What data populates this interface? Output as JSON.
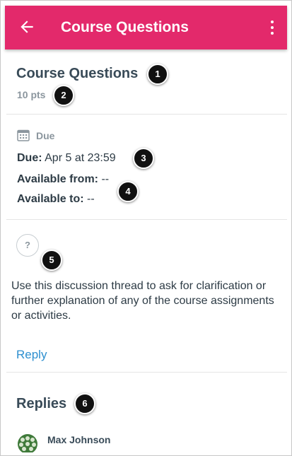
{
  "appbar": {
    "title": "Course Questions",
    "back_icon": "arrow-left-icon",
    "more_icon": "more-vertical-icon",
    "color": "#e3296b"
  },
  "assignment": {
    "title": "Course Questions",
    "points": "10 pts"
  },
  "dates": {
    "header": "Due",
    "due_label": "Due:",
    "due_value": "Apr 5 at 23:59",
    "available_from_label": "Available from:",
    "available_from_value": "--",
    "available_to_label": "Available to:",
    "available_to_value": "--"
  },
  "body": {
    "icon_glyph": "?",
    "description": "Use this discussion thread to ask for clarification or further explanation of any of the course assignments or activities.",
    "reply_label": "Reply",
    "link_color": "#2d8fcf"
  },
  "replies": {
    "header": "Replies",
    "items": [
      {
        "author": "Max Johnson"
      }
    ]
  },
  "callouts": [
    "1",
    "2",
    "3",
    "4",
    "5",
    "6"
  ]
}
